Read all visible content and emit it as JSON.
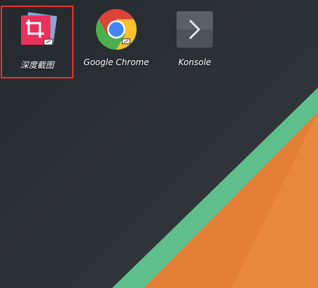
{
  "desktop": {
    "icons": [
      {
        "label": "深度截图",
        "icon": "deepin-screenshot-icon",
        "selected": true
      },
      {
        "label": "Google Chrome",
        "icon": "chrome-icon",
        "selected": false
      },
      {
        "label": "Konsole",
        "icon": "konsole-terminal-icon",
        "selected": false
      }
    ],
    "selection_color": "#e8332b",
    "wallpaper_colors": {
      "background": "#2c3136",
      "stripe": "#5fbf8c",
      "orange": "#e47f36"
    }
  }
}
